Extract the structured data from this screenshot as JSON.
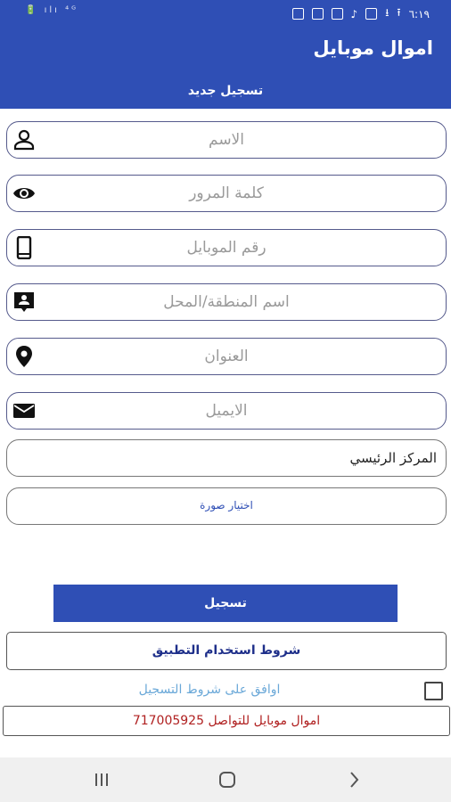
{
  "status_bar": {
    "time": "٦:١٩",
    "signal_text": "🔋 ılı ⁴ᴳ",
    "icons": [
      "play-icon",
      "image-icon",
      "image-icon",
      "music-icon",
      "screenshot-icon",
      "download-icon",
      "upload-icon"
    ]
  },
  "app": {
    "title": "اموال موبايل",
    "section_title": "تسجيل جديد"
  },
  "form": {
    "name_placeholder": "الاسم",
    "password_placeholder": "كلمة المرور",
    "mobile_placeholder": "رقم الموبايل",
    "region_placeholder": "اسم المنطقة/المحل",
    "address_placeholder": "العنوان",
    "email_placeholder": "الايميل",
    "branch_value": "المركز الرئيسي",
    "choose_image_label": "اختيار صورة"
  },
  "actions": {
    "register_label": "تسجيل",
    "terms_label": "شروط استخدام التطبيق",
    "agree_label": "اوافق على شروط التسجيل"
  },
  "contact": {
    "text": "اموال  موبايل للتواصل 717005925"
  },
  "colors": {
    "primary": "#2f4fb5",
    "link": "#6aa8d8",
    "contact": "#b02020"
  }
}
